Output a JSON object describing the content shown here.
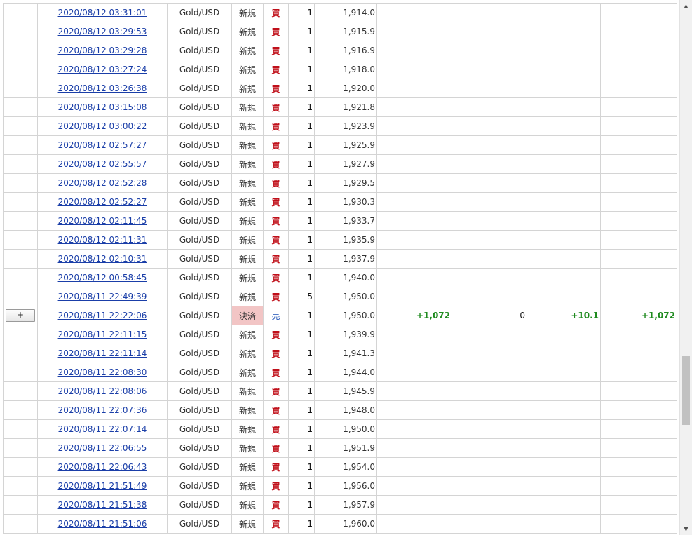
{
  "expand_label": "+",
  "scrollbar": {
    "up_arrow": "▲",
    "down_arrow": "▼"
  },
  "rows": [
    {
      "date": "2020/08/12 03:31:01",
      "symbol": "Gold/USD",
      "type": "新規",
      "side": "買",
      "qty": "1",
      "price": "1,914.0"
    },
    {
      "date": "2020/08/12 03:29:53",
      "symbol": "Gold/USD",
      "type": "新規",
      "side": "買",
      "qty": "1",
      "price": "1,915.9"
    },
    {
      "date": "2020/08/12 03:29:28",
      "symbol": "Gold/USD",
      "type": "新規",
      "side": "買",
      "qty": "1",
      "price": "1,916.9"
    },
    {
      "date": "2020/08/12 03:27:24",
      "symbol": "Gold/USD",
      "type": "新規",
      "side": "買",
      "qty": "1",
      "price": "1,918.0"
    },
    {
      "date": "2020/08/12 03:26:38",
      "symbol": "Gold/USD",
      "type": "新規",
      "side": "買",
      "qty": "1",
      "price": "1,920.0"
    },
    {
      "date": "2020/08/12 03:15:08",
      "symbol": "Gold/USD",
      "type": "新規",
      "side": "買",
      "qty": "1",
      "price": "1,921.8"
    },
    {
      "date": "2020/08/12 03:00:22",
      "symbol": "Gold/USD",
      "type": "新規",
      "side": "買",
      "qty": "1",
      "price": "1,923.9"
    },
    {
      "date": "2020/08/12 02:57:27",
      "symbol": "Gold/USD",
      "type": "新規",
      "side": "買",
      "qty": "1",
      "price": "1,925.9"
    },
    {
      "date": "2020/08/12 02:55:57",
      "symbol": "Gold/USD",
      "type": "新規",
      "side": "買",
      "qty": "1",
      "price": "1,927.9"
    },
    {
      "date": "2020/08/12 02:52:28",
      "symbol": "Gold/USD",
      "type": "新規",
      "side": "買",
      "qty": "1",
      "price": "1,929.5"
    },
    {
      "date": "2020/08/12 02:52:27",
      "symbol": "Gold/USD",
      "type": "新規",
      "side": "買",
      "qty": "1",
      "price": "1,930.3"
    },
    {
      "date": "2020/08/12 02:11:45",
      "symbol": "Gold/USD",
      "type": "新規",
      "side": "買",
      "qty": "1",
      "price": "1,933.7"
    },
    {
      "date": "2020/08/12 02:11:31",
      "symbol": "Gold/USD",
      "type": "新規",
      "side": "買",
      "qty": "1",
      "price": "1,935.9"
    },
    {
      "date": "2020/08/12 02:10:31",
      "symbol": "Gold/USD",
      "type": "新規",
      "side": "買",
      "qty": "1",
      "price": "1,937.9"
    },
    {
      "date": "2020/08/12 00:58:45",
      "symbol": "Gold/USD",
      "type": "新規",
      "side": "買",
      "qty": "1",
      "price": "1,940.0"
    },
    {
      "date": "2020/08/11 22:49:39",
      "symbol": "Gold/USD",
      "type": "新規",
      "side": "買",
      "qty": "5",
      "price": "1,950.0"
    },
    {
      "date": "2020/08/11 22:22:06",
      "symbol": "Gold/USD",
      "type": "決済",
      "side": "売",
      "qty": "1",
      "price": "1,950.0",
      "expandable": true,
      "settlement": true,
      "pl1": "+1,072",
      "pl2": "0",
      "pl3": "+10.1",
      "pl4": "+1,072"
    },
    {
      "date": "2020/08/11 22:11:15",
      "symbol": "Gold/USD",
      "type": "新規",
      "side": "買",
      "qty": "1",
      "price": "1,939.9"
    },
    {
      "date": "2020/08/11 22:11:14",
      "symbol": "Gold/USD",
      "type": "新規",
      "side": "買",
      "qty": "1",
      "price": "1,941.3"
    },
    {
      "date": "2020/08/11 22:08:30",
      "symbol": "Gold/USD",
      "type": "新規",
      "side": "買",
      "qty": "1",
      "price": "1,944.0"
    },
    {
      "date": "2020/08/11 22:08:06",
      "symbol": "Gold/USD",
      "type": "新規",
      "side": "買",
      "qty": "1",
      "price": "1,945.9"
    },
    {
      "date": "2020/08/11 22:07:36",
      "symbol": "Gold/USD",
      "type": "新規",
      "side": "買",
      "qty": "1",
      "price": "1,948.0"
    },
    {
      "date": "2020/08/11 22:07:14",
      "symbol": "Gold/USD",
      "type": "新規",
      "side": "買",
      "qty": "1",
      "price": "1,950.0"
    },
    {
      "date": "2020/08/11 22:06:55",
      "symbol": "Gold/USD",
      "type": "新規",
      "side": "買",
      "qty": "1",
      "price": "1,951.9"
    },
    {
      "date": "2020/08/11 22:06:43",
      "symbol": "Gold/USD",
      "type": "新規",
      "side": "買",
      "qty": "1",
      "price": "1,954.0"
    },
    {
      "date": "2020/08/11 21:51:49",
      "symbol": "Gold/USD",
      "type": "新規",
      "side": "買",
      "qty": "1",
      "price": "1,956.0"
    },
    {
      "date": "2020/08/11 21:51:38",
      "symbol": "Gold/USD",
      "type": "新規",
      "side": "買",
      "qty": "1",
      "price": "1,957.9"
    },
    {
      "date": "2020/08/11 21:51:06",
      "symbol": "Gold/USD",
      "type": "新規",
      "side": "買",
      "qty": "1",
      "price": "1,960.0"
    }
  ]
}
